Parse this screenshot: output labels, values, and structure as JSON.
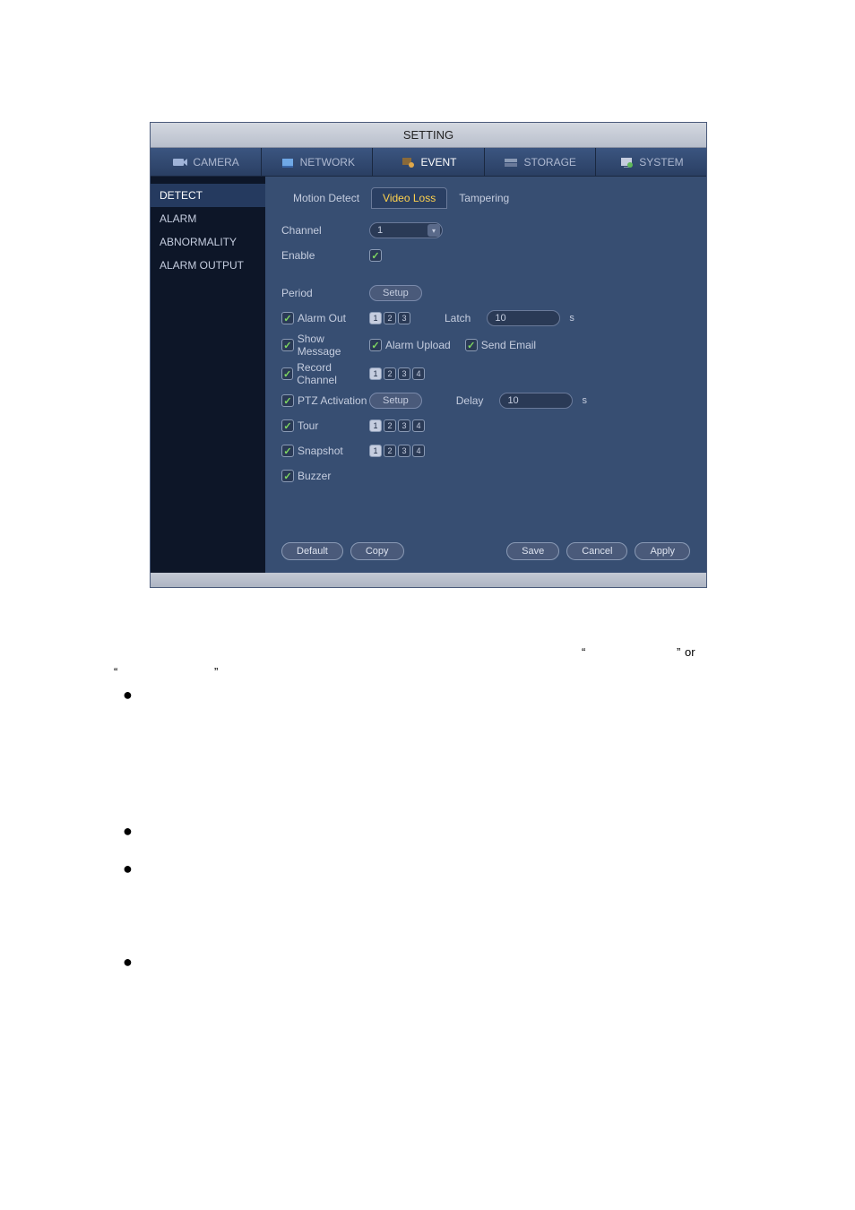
{
  "title": "SETTING",
  "nav": {
    "camera": "CAMERA",
    "network": "NETWORK",
    "event": "EVENT",
    "storage": "STORAGE",
    "system": "SYSTEM"
  },
  "sidebar": {
    "detect": "DETECT",
    "alarm": "ALARM",
    "abnormality": "ABNORMALITY",
    "alarm_output": "ALARM OUTPUT"
  },
  "subtabs": {
    "motion_detect": "Motion Detect",
    "video_loss": "Video Loss",
    "tampering": "Tampering"
  },
  "labels": {
    "channel": "Channel",
    "enable": "Enable",
    "period": "Period",
    "alarm_out": "Alarm Out",
    "latch": "Latch",
    "show_message": "Show Message",
    "alarm_upload": "Alarm Upload",
    "send_email": "Send Email",
    "record_channel": "Record Channel",
    "ptz_activation": "PTZ Activation",
    "delay": "Delay",
    "tour": "Tour",
    "snapshot": "Snapshot",
    "buzzer": "Buzzer",
    "setup": "Setup",
    "unit_s": "s"
  },
  "values": {
    "channel": "1",
    "latch": "10",
    "delay": "10"
  },
  "alarm_out_nums": [
    "1",
    "2",
    "3"
  ],
  "record_nums": [
    "1",
    "2",
    "3",
    "4"
  ],
  "tour_nums": [
    "1",
    "2",
    "3",
    "4"
  ],
  "snapshot_nums": [
    "1",
    "2",
    "3",
    "4"
  ],
  "buttons": {
    "default": "Default",
    "copy": "Copy",
    "save": "Save",
    "cancel": "Cancel",
    "apply": "Apply"
  },
  "surround_text": {
    "or": "or",
    "q1": "“",
    "q2": "”",
    "q3": "“",
    "q4": "”"
  }
}
